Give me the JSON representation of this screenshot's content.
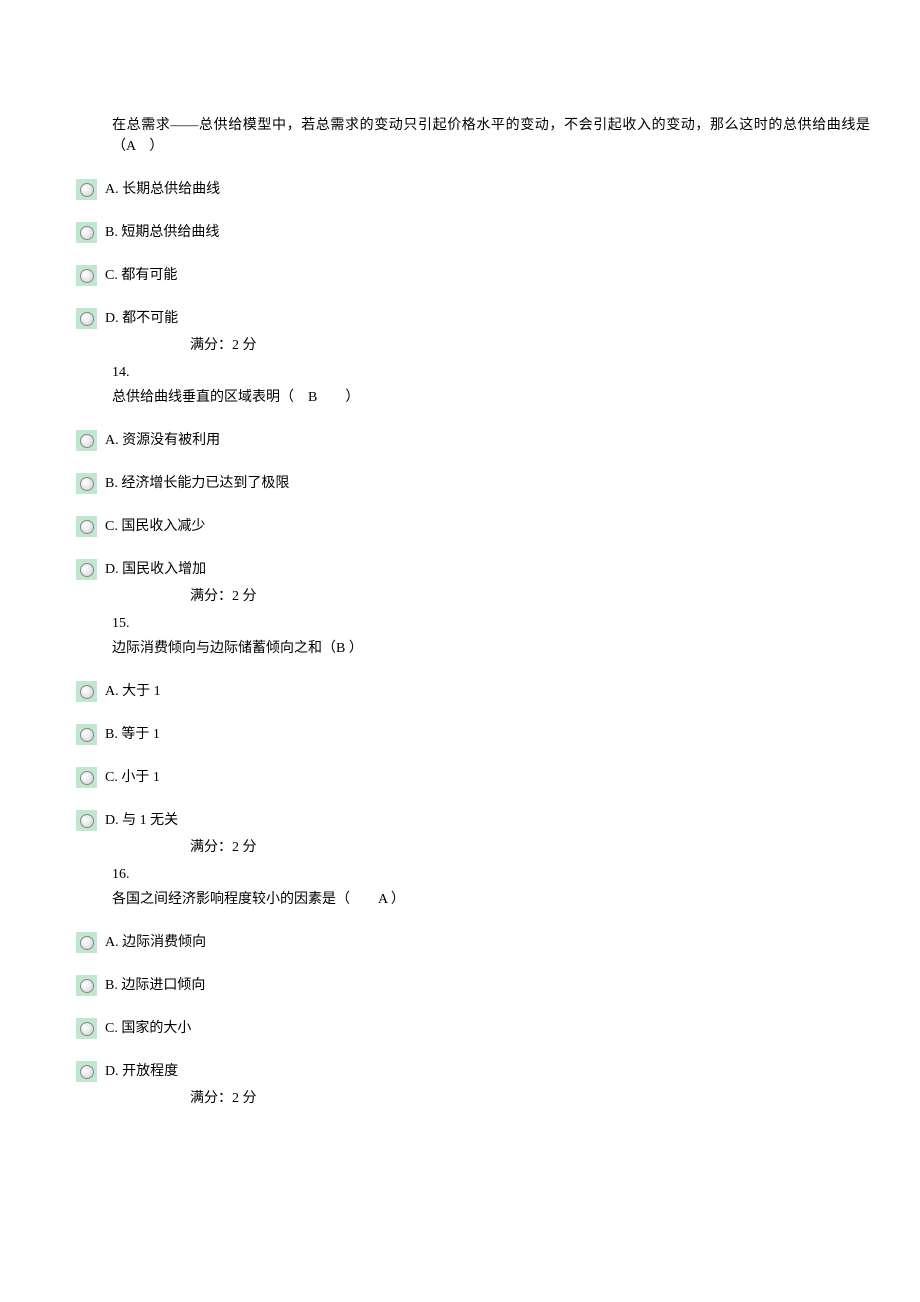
{
  "q13": {
    "stem": "在总需求——总供给模型中，若总需求的变动只引起价格水平的变动，不会引起收入的变动，那么这时的总供给曲线是（A　）",
    "options": {
      "A": "A. 长期总供给曲线",
      "B": "B. 短期总供给曲线",
      "C": "C. 都有可能",
      "D": "D. 都不可能"
    },
    "score": "满分：2    分"
  },
  "q14": {
    "num": "14.",
    "stem": "总供给曲线垂直的区域表明（　B　　）",
    "options": {
      "A": "A. 资源没有被利用",
      "B": "B. 经济增长能力已达到了极限",
      "C": "C. 国民收入减少",
      "D": "D. 国民收入增加"
    },
    "score": "满分：2    分"
  },
  "q15": {
    "num": "15.",
    "stem": "边际消费倾向与边际储蓄倾向之和（B ）",
    "options": {
      "A": "A. 大于 1",
      "B": "B. 等于 1",
      "C": "C. 小于 1",
      "D": "D. 与 1 无关"
    },
    "score": "满分：2    分"
  },
  "q16": {
    "num": "16.",
    "stem": "各国之间经济影响程度较小的因素是（　　A ）",
    "options": {
      "A": "A. 边际消费倾向",
      "B": "B. 边际进口倾向",
      "C": "C. 国家的大小",
      "D": "D. 开放程度"
    },
    "score": "满分：2    分"
  }
}
